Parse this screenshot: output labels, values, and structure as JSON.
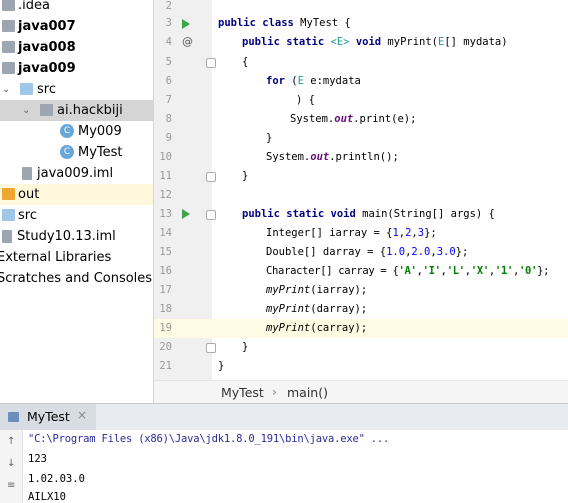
{
  "project_tree": {
    "items": [
      {
        "label": ".idea",
        "bold": false
      },
      {
        "label": "java007",
        "bold": true
      },
      {
        "label": "java008",
        "bold": true
      },
      {
        "label": "java009",
        "bold": true
      },
      {
        "label": "src",
        "bold": false
      },
      {
        "label": "ai.hackbiji",
        "bold": false
      },
      {
        "label": "My009",
        "bold": false
      },
      {
        "label": "MyTest",
        "bold": false
      },
      {
        "label": "java009.iml",
        "bold": false
      },
      {
        "label": "out",
        "bold": false
      },
      {
        "label": "src",
        "bold": false
      },
      {
        "label": "Study10.13.iml",
        "bold": false
      },
      {
        "label": "External Libraries",
        "bold": false
      },
      {
        "label": "Scratches and Consoles",
        "bold": false
      }
    ]
  },
  "editor": {
    "line_numbers": [
      "2",
      "3",
      "4",
      "5",
      "6",
      "7",
      "8",
      "9",
      "10",
      "11",
      "12",
      "13",
      "14",
      "15",
      "16",
      "17",
      "18",
      "19",
      "20",
      "21"
    ],
    "line3": {
      "kw1": "public class",
      "rest": " MyTest {"
    },
    "line4": {
      "kw1": "public static",
      "gen": "<E>",
      "kw2": "void",
      "rest": " myPrint(",
      "gen2": "E",
      "rest2": "[] mydata)"
    },
    "line5": "{",
    "line6": {
      "kw": "for",
      "rest1": " (",
      "gen": "E",
      "rest2": " e:mydata"
    },
    "line7": ") {",
    "line8": {
      "pre": "System.",
      "fld": "out",
      "post": ".print(e);"
    },
    "line9": "}",
    "line10": {
      "pre": "System.",
      "fld": "out",
      "post": ".println();"
    },
    "line11": "}",
    "line13": {
      "kw": "public static void",
      "rest": " main(String[] args) {"
    },
    "line14": {
      "pre": "Integer[] iarray = {",
      "n1": "1",
      "c1": ",",
      "n2": "2",
      "c2": ",",
      "n3": "3",
      "post": "};"
    },
    "line15": {
      "pre": "Double[] darray = {",
      "n1": "1.0",
      "c1": ",",
      "n2": "2.0",
      "c2": ",",
      "n3": "3.0",
      "post": "};"
    },
    "line16": {
      "pre": "Character[] carray = {",
      "s1": "'A'",
      "s2": "'I'",
      "s3": "'L'",
      "s4": "'X'",
      "s5": "'1'",
      "s6": "'0'",
      "post": "};"
    },
    "line17": {
      "call": "myPrint",
      "args": "(iarray);"
    },
    "line18": {
      "call": "myPrint",
      "args": "(darray);"
    },
    "line19": {
      "call": "myPrint",
      "args": "(carray);"
    },
    "line20": "}",
    "line21": "}",
    "gutter_at": "@"
  },
  "breadcrumb": {
    "class": "MyTest",
    "sep": "›",
    "method": "main()"
  },
  "run_panel": {
    "tab_label": "MyTest",
    "close": "×"
  },
  "console": {
    "lines": [
      "\"C:\\Program Files (x86)\\Java\\jdk1.8.0_191\\bin\\java.exe\" ...",
      "123",
      "1.02.03.0",
      "AILX10"
    ]
  }
}
